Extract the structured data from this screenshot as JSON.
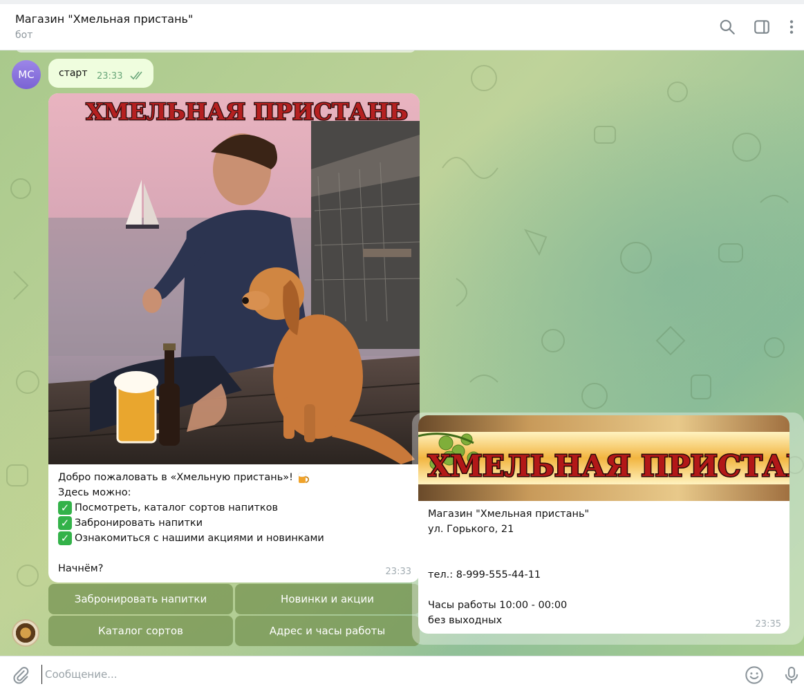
{
  "header": {
    "title": "Магазин \"Хмельная пристань\"",
    "subtitle": "бот"
  },
  "icons": {
    "search": "search-icon",
    "side_panel": "sidebar-toggle-icon",
    "more": "more-vertical-icon",
    "attach": "paperclip-icon",
    "emoji": "emoji-icon",
    "voice": "microphone-icon"
  },
  "user": {
    "avatar_initials": "МС",
    "avatar_color": "#8a74de"
  },
  "messages": {
    "outgoing": {
      "text": "старт",
      "time": "23:33"
    },
    "welcome": {
      "image_title": "ХМЕЛЬНАЯ ПРИСТАНЬ",
      "lines": [
        "Добро пожаловать в «Хмельную пристань»!",
        "Здесь можно:",
        "Посмотреть, каталог сортов напитков",
        "Забронировать напитки",
        "Ознакомиться с нашими акциями и новинками",
        "",
        "Начнём?"
      ],
      "time": "23:33"
    },
    "info": {
      "banner_title": "ХМЕЛЬНАЯ ПРИСТАНЬ",
      "lines": [
        "Магазин \"Хмельная пристань\"",
        "ул. Горького, 21",
        "",
        "",
        "тел.: 8-999-555-44-11",
        "",
        "Часы работы 10:00 - 00:00",
        "без выходных"
      ],
      "time": "23:35"
    }
  },
  "keyboard": {
    "book": "Забронировать напитки",
    "news": "Новинки и акции",
    "catalog": "Каталог сортов",
    "address": "Адрес и часы работы"
  },
  "composer": {
    "placeholder": "Сообщение..."
  },
  "colors": {
    "accent": "#33b249",
    "outgoing_bubble": "#effdde",
    "keyboard_button": "#7a9655"
  }
}
